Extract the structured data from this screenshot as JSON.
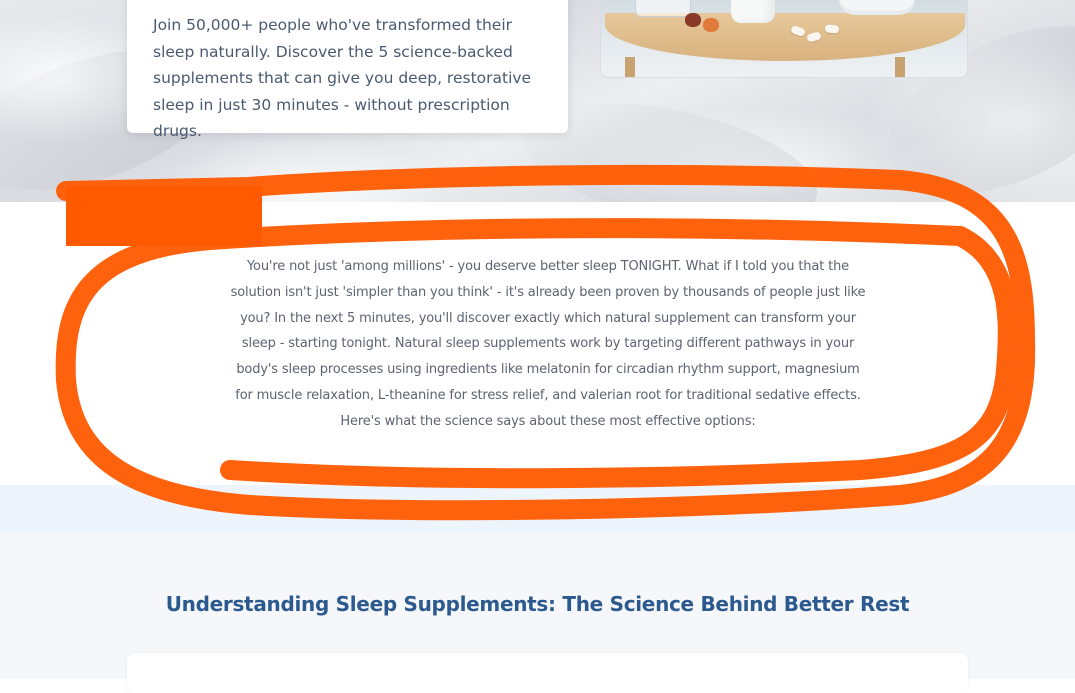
{
  "hero": {
    "body_text": "Join 50,000+ people who've transformed their sleep naturally. Discover the 5 science-backed supplements that can give you deep, restorative sleep in just 30 minutes - without prescription drugs.",
    "image_icon": "supplements-on-table-photo"
  },
  "intro": {
    "paragraph": "You're not just 'among millions' - you deserve better sleep TONIGHT. What if I told you that the solution isn't just 'simpler than you think' - it's already been proven by thousands of people just like you? In the next 5 minutes, you'll discover exactly which natural supplement can transform your sleep - starting tonight. Natural sleep supplements work by targeting different pathways in your body's sleep processes using ingredients like melatonin for circadian rhythm support, magnesium for muscle relaxation, L-theanine for stress relief, and valerian root for traditional sedative effects. Here's what the science says about these most effective options:"
  },
  "science": {
    "heading": "Understanding Sleep Supplements: The Science Behind Better Rest"
  },
  "annotation": {
    "color": "#ff5a00",
    "icon": "hand-drawn-circle-markup"
  },
  "colors": {
    "heading_blue": "#2d5a8e",
    "body_text": "#5b6470",
    "band_blue": "#eef4fb"
  }
}
